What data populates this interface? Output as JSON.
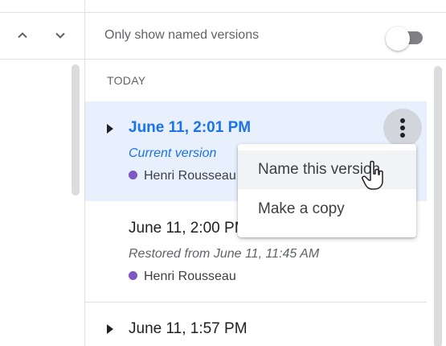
{
  "header": {
    "toggle_label": "Only show named versions",
    "toggle_on": false
  },
  "nav": {
    "up_icon": "chevron-up-icon",
    "down_icon": "chevron-down-icon"
  },
  "section": {
    "label": "TODAY"
  },
  "versions": [
    {
      "title": "June 11, 2:01 PM",
      "subtitle": "Current version",
      "author": "Henri Rousseau",
      "selected": true,
      "expandable": true
    },
    {
      "title": "June 11, 2:00 PM",
      "subtitle": "Restored from June 11, 11:45 AM",
      "author": "Henri Rousseau",
      "selected": false,
      "expandable": false
    },
    {
      "title": "June 11, 1:57 PM",
      "selected": false,
      "expandable": true
    }
  ],
  "menu": {
    "items": [
      {
        "label": "Name this version"
      },
      {
        "label": "Make a copy"
      }
    ]
  },
  "colors": {
    "accent": "#1a73e8",
    "selected_bg": "#e8f0fe",
    "author_dot": "#7e57c2"
  }
}
